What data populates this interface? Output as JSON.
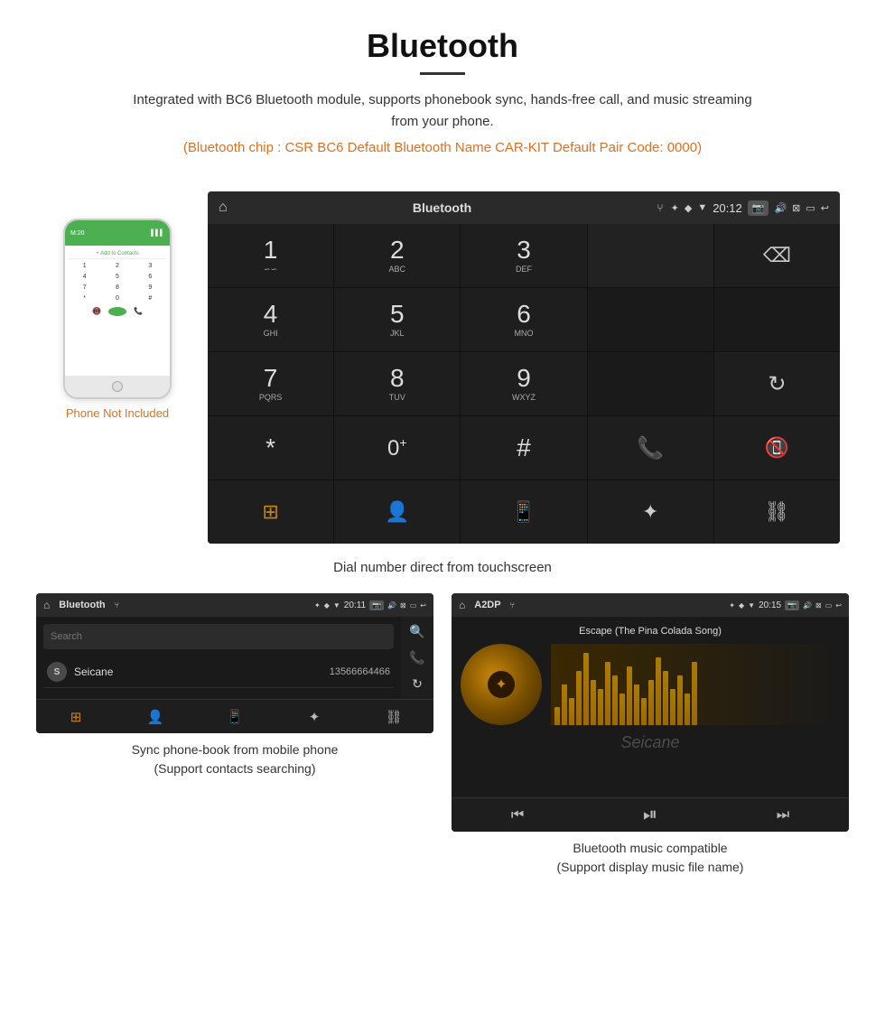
{
  "page": {
    "title": "Bluetooth",
    "description": "Integrated with BC6 Bluetooth module, supports phonebook sync, hands-free call, and music streaming from your phone.",
    "specs": "(Bluetooth chip : CSR BC6    Default Bluetooth Name CAR-KIT    Default Pair Code: 0000)"
  },
  "main_screen": {
    "status_bar": {
      "title": "Bluetooth",
      "time": "20:12",
      "usb_icon": "⑂",
      "bt_icon": "✦",
      "loc_icon": "♦",
      "wifi_icon": "▼"
    },
    "dial_keys": [
      {
        "num": "1",
        "sub": "∽∽"
      },
      {
        "num": "2",
        "sub": "ABC"
      },
      {
        "num": "3",
        "sub": "DEF"
      },
      {
        "num": "4",
        "sub": "GHI"
      },
      {
        "num": "5",
        "sub": "JKL"
      },
      {
        "num": "6",
        "sub": "MNO"
      },
      {
        "num": "7",
        "sub": "PQRS"
      },
      {
        "num": "8",
        "sub": "TUV"
      },
      {
        "num": "9",
        "sub": "WXYZ"
      },
      {
        "num": "*",
        "sub": ""
      },
      {
        "num": "0",
        "sub": "+"
      },
      {
        "num": "#",
        "sub": ""
      }
    ]
  },
  "phone_aside": {
    "not_included": "Phone Not Included"
  },
  "main_caption": "Dial number direct from touchscreen",
  "phonebook_screen": {
    "status_bar": {
      "title": "Bluetooth",
      "time": "20:11"
    },
    "search_placeholder": "Search",
    "contacts": [
      {
        "initial": "S",
        "name": "Seicane",
        "phone": "13566664466"
      }
    ]
  },
  "music_screen": {
    "status_bar": {
      "title": "A2DP",
      "time": "20:15"
    },
    "song_title": "Escape (The Pina Colada Song)"
  },
  "bottom_captions": {
    "phonebook": "Sync phone-book from mobile phone",
    "phonebook_sub": "(Support contacts searching)",
    "music": "Bluetooth music compatible",
    "music_sub": "(Support display music file name)"
  },
  "watermark": "Seicane",
  "eq_heights": [
    20,
    45,
    30,
    60,
    80,
    50,
    40,
    70,
    55,
    35,
    65,
    45,
    30,
    50,
    75,
    60,
    40,
    55,
    35,
    70
  ]
}
